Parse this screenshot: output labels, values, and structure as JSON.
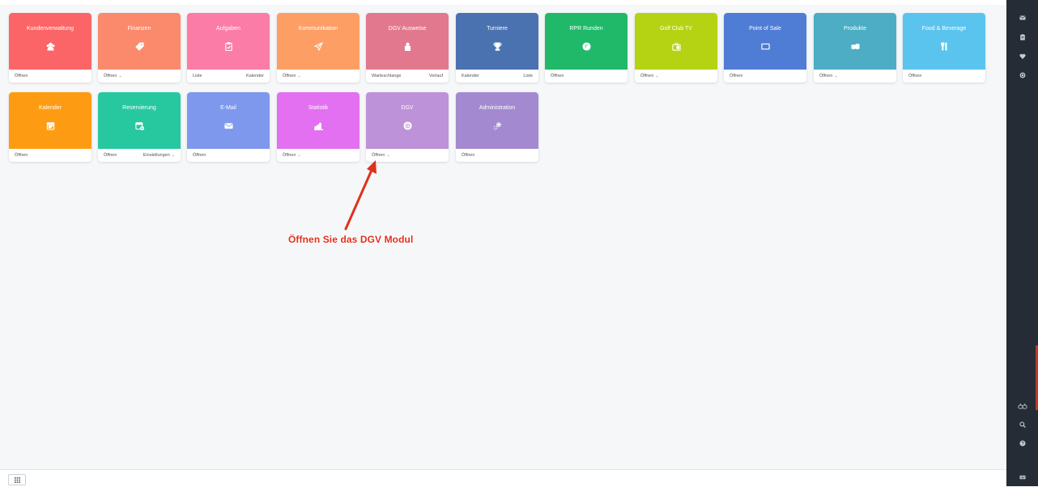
{
  "tiles": [
    {
      "title": "Kundenverwaltung",
      "color": "#fb6567",
      "icon": "user-group-icon",
      "footer": {
        "left": "Öffnen",
        "right": "",
        "dropdown": false
      }
    },
    {
      "title": "Finanzen",
      "color": "#fb8a6c",
      "icon": "tag-icon",
      "footer": {
        "left": "Öffnen",
        "right": "",
        "dropdown": true
      }
    },
    {
      "title": "Aufgaben",
      "color": "#fb7ca6",
      "icon": "clipboard-check-icon",
      "footer": {
        "left": "Liste",
        "right": "Kalender",
        "dropdown": false
      }
    },
    {
      "title": "Kommunikation",
      "color": "#fd9f64",
      "icon": "paper-plane-icon",
      "footer": {
        "left": "Öffnen",
        "right": "",
        "dropdown": true
      }
    },
    {
      "title": "DGV Ausweise",
      "color": "#e2788e",
      "icon": "id-stack-icon",
      "footer": {
        "left": "Warteschlange",
        "right": "Verlauf",
        "dropdown": false
      }
    },
    {
      "title": "Turniere",
      "color": "#4a72b0",
      "icon": "trophy-icon",
      "footer": {
        "left": "Kalender",
        "right": "Liste",
        "dropdown": false
      }
    },
    {
      "title": "RPR Runden",
      "color": "#20b96a",
      "icon": "golf-ball-icon",
      "footer": {
        "left": "Öffnen",
        "right": "",
        "dropdown": false
      }
    },
    {
      "title": "Golf Club TV",
      "color": "#b5d313",
      "icon": "tv-icon",
      "footer": {
        "left": "Öffnen",
        "right": "",
        "dropdown": true
      }
    },
    {
      "title": "Point of Sale",
      "color": "#4f7cd5",
      "icon": "register-icon",
      "footer": {
        "left": "Öffnen",
        "right": "",
        "dropdown": false
      }
    },
    {
      "title": "Produkte",
      "color": "#4cadc5",
      "icon": "products-icon",
      "footer": {
        "left": "Öffnen",
        "right": "",
        "dropdown": true
      }
    },
    {
      "title": "Food & Beverage",
      "color": "#5ac4ef",
      "icon": "cutlery-icon",
      "footer": {
        "left": "Öffnen",
        "right": "",
        "dropdown": false
      }
    },
    {
      "title": "Kalender",
      "color": "#fd9c12",
      "icon": "calendar-icon",
      "footer": {
        "left": "Öffnen",
        "right": "",
        "dropdown": false
      }
    },
    {
      "title": "Reservierung",
      "color": "#27c8a0",
      "icon": "calendar-plus-icon",
      "footer": {
        "left": "Öffnen",
        "right": "Einstellungen",
        "dropdown": true
      }
    },
    {
      "title": "E-Mail",
      "color": "#7e98ed",
      "icon": "envelope-icon",
      "footer": {
        "left": "Öffnen",
        "right": "",
        "dropdown": false
      }
    },
    {
      "title": "Statistik",
      "color": "#e270f0",
      "icon": "bar-chart-icon",
      "footer": {
        "left": "Öffnen",
        "right": "",
        "dropdown": true
      }
    },
    {
      "title": "DGV",
      "color": "#bd92d8",
      "icon": "dgv-badge-icon",
      "footer": {
        "left": "Öffnen",
        "right": "",
        "dropdown": true
      }
    },
    {
      "title": "Administration",
      "color": "#a38ad0",
      "icon": "gears-icon",
      "footer": {
        "left": "Öffnen",
        "right": "",
        "dropdown": false
      }
    }
  ],
  "annotation": {
    "text": "Öffnen Sie das DGV Modul",
    "color": "#e0301e"
  },
  "sidebar": {
    "icons": [
      "envelope-icon",
      "clipboard-icon",
      "heart-icon",
      "coin-icon",
      "link-icon",
      "search-icon",
      "help-icon",
      "keyboard-icon"
    ],
    "background": "#252c35"
  },
  "bottom_bar": {
    "icon": "apps-grid-icon"
  }
}
